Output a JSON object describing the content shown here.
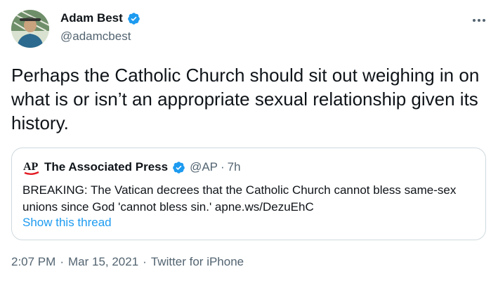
{
  "author": {
    "display_name": "Adam Best",
    "handle": "@adamcbest"
  },
  "tweet": {
    "text": "Perhaps the Catholic Church should sit out weighing in on what is or isn’t an appropriate sexual relationship given its history."
  },
  "quoted": {
    "logo_text": "AP",
    "display_name": "The Associated Press",
    "handle": "@AP",
    "dot": "·",
    "time": "7h",
    "text": "BREAKING: The Vatican decrees that the Catholic Church cannot bless same-sex unions since God 'cannot bless sin.' apne.ws/DezuEhC",
    "show_thread": "Show this thread"
  },
  "footer": {
    "time": "2:07 PM",
    "date": "Mar 15, 2021",
    "source": "Twitter for iPhone",
    "separator": "·"
  },
  "colors": {
    "verified": "#1d9bf0",
    "link": "#1d9bf0",
    "muted": "#536471",
    "border": "#cfd9de",
    "ap_red": "#e31c23"
  },
  "icons": {
    "verified": "verified-badge-icon",
    "more": "more-horizontal-icon"
  }
}
